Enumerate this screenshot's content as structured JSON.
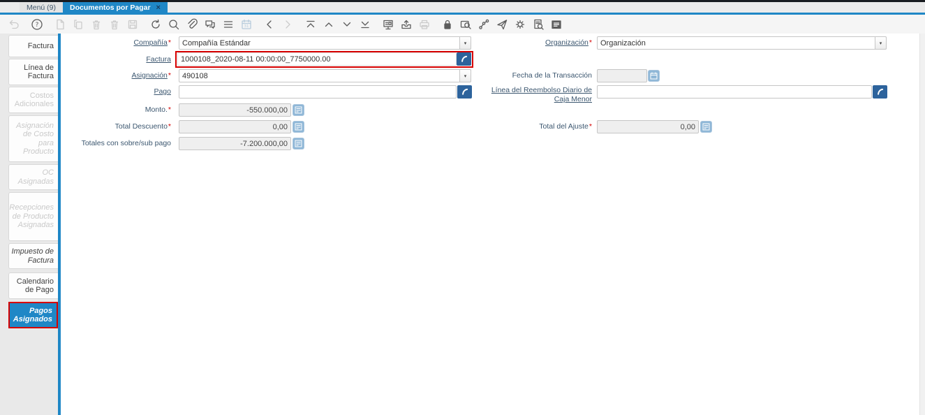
{
  "window": {
    "tabs": [
      {
        "label": "Menú (9)"
      },
      {
        "label": "Documentos por Pagar",
        "close_icon": "×"
      }
    ]
  },
  "toolbar": {
    "icons": [
      {
        "name": "undo-icon",
        "enabled": false
      },
      {
        "name": "help-icon",
        "enabled": true
      },
      {
        "name": "new-record-icon",
        "enabled": false
      },
      {
        "name": "copy-record-icon",
        "enabled": false
      },
      {
        "name": "delete-record-icon",
        "enabled": false
      },
      {
        "name": "delete-selection-icon",
        "enabled": false
      },
      {
        "name": "save-icon",
        "enabled": false
      },
      {
        "name": "refresh-icon",
        "enabled": true
      },
      {
        "name": "find-icon",
        "enabled": true
      },
      {
        "name": "attachment-icon",
        "enabled": true
      },
      {
        "name": "chat-icon",
        "enabled": true
      },
      {
        "name": "grid-toggle-icon",
        "enabled": true
      },
      {
        "name": "calendar-icon",
        "enabled": false
      },
      {
        "name": "parent-record-icon",
        "enabled": true
      },
      {
        "name": "detail-record-icon",
        "enabled": false
      },
      {
        "name": "first-record-icon",
        "enabled": true
      },
      {
        "name": "previous-record-icon",
        "enabled": true
      },
      {
        "name": "next-record-icon",
        "enabled": true
      },
      {
        "name": "last-record-icon",
        "enabled": true
      },
      {
        "name": "report-icon",
        "enabled": true
      },
      {
        "name": "archive-icon",
        "enabled": true
      },
      {
        "name": "print-icon",
        "enabled": false
      },
      {
        "name": "lock-icon",
        "enabled": true
      },
      {
        "name": "zoom-across-icon",
        "enabled": true
      },
      {
        "name": "workflow-icon",
        "enabled": true
      },
      {
        "name": "send-icon",
        "enabled": true
      },
      {
        "name": "process-icon",
        "enabled": true
      },
      {
        "name": "export-icon",
        "enabled": true
      },
      {
        "name": "quick-form-icon",
        "enabled": true
      }
    ]
  },
  "sidebar": {
    "tabs": [
      {
        "label": "Factura",
        "state": "enabled"
      },
      {
        "label": "Línea de Factura",
        "state": "enabled"
      },
      {
        "label": "Costos Adicionales",
        "state": "disabled"
      },
      {
        "label": "Asignación de Costo para Producto",
        "state": "disabled-italic"
      },
      {
        "label": "OC Asignadas",
        "state": "disabled-italic"
      },
      {
        "label": "Recepciones de Producto Asignadas",
        "state": "disabled-italic"
      },
      {
        "label": "Impuesto de Factura",
        "state": "enabled-italic"
      },
      {
        "label": "Calendario de Pago",
        "state": "enabled"
      },
      {
        "label": "Pagos Asignados",
        "state": "selected",
        "highlighted": true
      }
    ]
  },
  "form": {
    "compania": {
      "label": "Compañía",
      "req": "*",
      "value": "Compañía Estándar"
    },
    "organizacion": {
      "label": "Organización",
      "req": "*",
      "value": "Organización"
    },
    "factura": {
      "label": "Factura",
      "value": "1000108_2020-08-11 00:00:00_7750000.00",
      "highlighted": true
    },
    "asignacion": {
      "label": "Asignación",
      "req": "*",
      "value": "490108"
    },
    "fecha_transaccion": {
      "label": "Fecha de la Transacción",
      "value": ""
    },
    "pago": {
      "label": "Pago",
      "value": ""
    },
    "linea_reembolso": {
      "label": "Línea del Reembolso Diario de Caja Menor",
      "value": ""
    },
    "monto": {
      "label": "Monto.",
      "req": "*",
      "value": "-550.000,00"
    },
    "total_descuento": {
      "label": "Total Descuento",
      "req": "*",
      "value": "0,00"
    },
    "total_ajuste": {
      "label": "Total del Ajuste",
      "req": "*",
      "value": "0,00"
    },
    "totales_sobre_sub_pago": {
      "label": "Totales con sobre/sub pago",
      "value": "-7.200.000,00"
    }
  },
  "glyphs": {
    "dropdown": "▾"
  },
  "colors": {
    "accent_blue": "#1f87c6",
    "button_blue": "#2d639c",
    "light_button_blue": "#8fb7d7",
    "highlight_red": "#d60000",
    "required_red": "#d40000"
  }
}
